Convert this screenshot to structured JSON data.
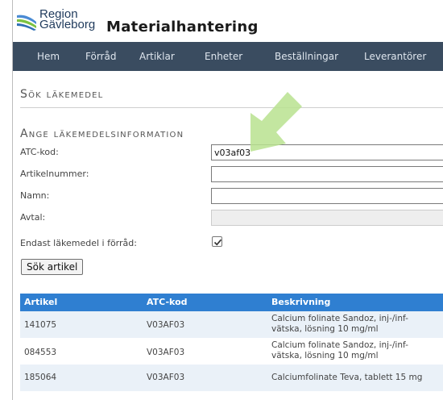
{
  "header": {
    "brand_line1": "Region",
    "brand_line2": "Gävleborg",
    "app_title": "Materialhantering",
    "logo_colors": [
      "#4a8bd4",
      "#7cc242"
    ]
  },
  "nav": {
    "items": [
      {
        "label": "Hem"
      },
      {
        "label": "Förråd"
      },
      {
        "label": "Artiklar"
      },
      {
        "label": "Enheter"
      },
      {
        "label": "Beställningar"
      },
      {
        "label": "Leverantörer"
      }
    ]
  },
  "search": {
    "title": "Sök läkemedel",
    "subtitle": "Ange läkemedelsinformation",
    "fields": {
      "atc": {
        "label": "ATC-kod:",
        "value": "v03af03"
      },
      "article_number": {
        "label": "Artikelnummer:",
        "value": ""
      },
      "name": {
        "label": "Namn:",
        "value": ""
      },
      "agreement": {
        "label": "Avtal:",
        "value": ""
      }
    },
    "only_in_stock": {
      "label": "Endast läkemedel i förråd:",
      "checked": true
    },
    "search_button": "Sök artikel"
  },
  "results": {
    "headers": [
      "Artikel",
      "ATC-kod",
      "Beskrivning"
    ],
    "rows": [
      {
        "article": "141075",
        "atc": "V03AF03",
        "desc1": "Calcium folinate Sandoz, inj-/inf-",
        "desc2": "vätska, lösning 10 mg/ml"
      },
      {
        "article": "084553",
        "atc": "V03AF03",
        "desc1": "Calcium folinate Sandoz, inj-/inf-",
        "desc2": "vätska, lösning 10 mg/ml"
      },
      {
        "article": "185064",
        "atc": "V03AF03",
        "desc1": "Calciumfolinate Teva, tablett 15 mg",
        "desc2": ""
      }
    ]
  },
  "colors": {
    "nav_bg": "#3a4c60",
    "table_header": "#2f7fd1",
    "row_alt": "#eaf1f8",
    "annotation_arrow": "#b9e28f"
  }
}
